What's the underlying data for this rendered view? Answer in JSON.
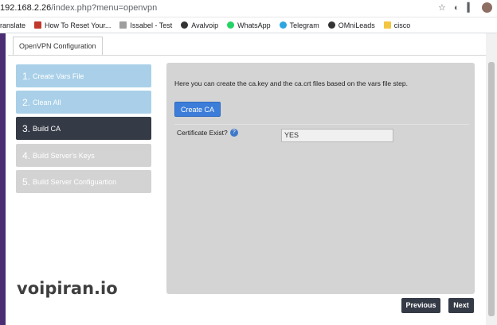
{
  "browser": {
    "url_host": "192.168.2.26",
    "url_path": "/index.php?menu=openvpn",
    "bookmarks": [
      {
        "label": "ranslate",
        "icon": "translate-icon",
        "color": "#4285f4"
      },
      {
        "label": "How To Reset Your...",
        "icon": "bookmark-favicon-icon",
        "color": "#c0392b"
      },
      {
        "label": "Issabel - Test",
        "icon": "issabel-icon",
        "color": "#9e9e9e"
      },
      {
        "label": "Avalvoip",
        "icon": "globe-icon",
        "color": "#333333"
      },
      {
        "label": "WhatsApp",
        "icon": "whatsapp-icon",
        "color": "#25d366"
      },
      {
        "label": "Telegram",
        "icon": "telegram-icon",
        "color": "#2ca5e0"
      },
      {
        "label": "OMniLeads",
        "icon": "globe-icon",
        "color": "#333333"
      },
      {
        "label": "cisco",
        "icon": "folder-icon",
        "color": "#f4c542"
      }
    ]
  },
  "page": {
    "tab_label": "OpenVPN Configuration",
    "steps": [
      {
        "num": "1.",
        "label": "Create Vars File",
        "state": "done"
      },
      {
        "num": "2.",
        "label": "Clean All",
        "state": "done"
      },
      {
        "num": "3.",
        "label": "Build CA",
        "state": "active"
      },
      {
        "num": "4.",
        "label": "Build Server's Keys",
        "state": "todo"
      },
      {
        "num": "5.",
        "label": "Build Server Configuartion",
        "state": "todo"
      }
    ],
    "description": "Here you can create the ca.key and the ca.crt files based on the vars file step.",
    "create_button": "Create CA",
    "cert_label": "Certificate Exist?",
    "cert_value": "YES",
    "previous_button": "Previous",
    "next_button": "Next"
  },
  "watermark": "voipiran.io",
  "colors": {
    "step_done": "#a9d0e8",
    "step_active": "#343a46",
    "step_todo": "#d3d3d3",
    "primary_button": "#3b7dd8",
    "nav_button": "#343a46"
  }
}
